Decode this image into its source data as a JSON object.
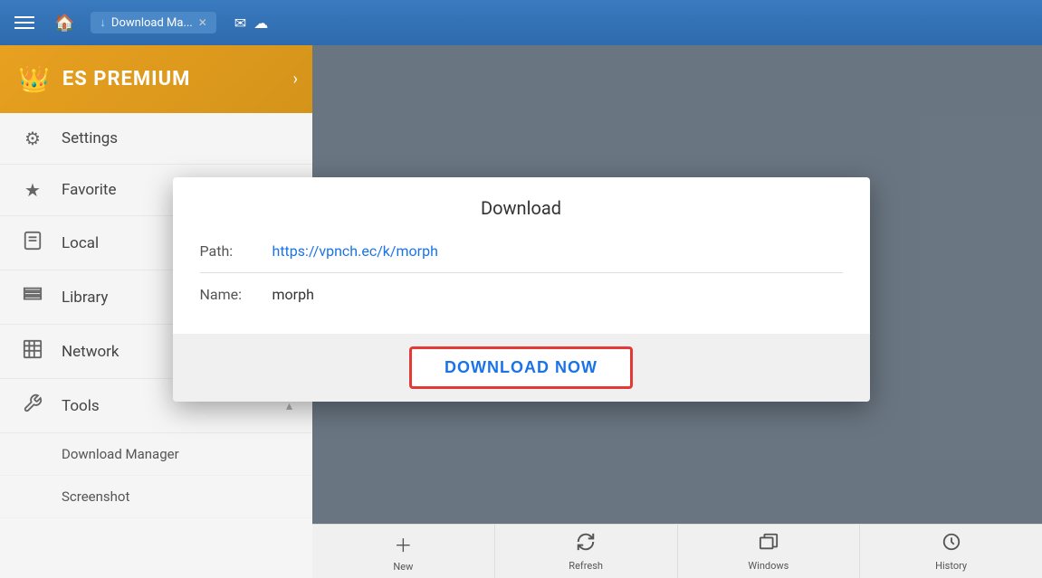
{
  "topBar": {
    "tabLabel": "Download Ma...",
    "icons": [
      "mail",
      "cloud"
    ]
  },
  "sidebar": {
    "premium": {
      "label": "ES PREMIUM",
      "crownIcon": "👑"
    },
    "items": [
      {
        "id": "settings",
        "label": "Settings",
        "icon": "⚙"
      },
      {
        "id": "favorite",
        "label": "Favorite",
        "icon": "★"
      },
      {
        "id": "local",
        "label": "Local",
        "icon": "📱"
      },
      {
        "id": "library",
        "label": "Library",
        "icon": "≡"
      },
      {
        "id": "network",
        "label": "Network",
        "icon": "▦"
      },
      {
        "id": "tools",
        "label": "Tools",
        "icon": "🔧"
      }
    ],
    "subitems": [
      {
        "id": "download-manager",
        "label": "Download Manager"
      },
      {
        "id": "screenshot",
        "label": "Screenshot"
      }
    ]
  },
  "dialog": {
    "title": "Download",
    "pathLabel": "Path:",
    "pathValue": "https://vpnch.ec/k/morph",
    "nameLabel": "Name:",
    "nameValue": "morph",
    "downloadButtonLabel": "DOWNLOAD NOW"
  },
  "bottomBar": {
    "buttons": [
      {
        "id": "new",
        "label": "New",
        "icon": "+"
      },
      {
        "id": "refresh",
        "label": "Refresh",
        "icon": "↻"
      },
      {
        "id": "windows",
        "label": "Windows",
        "icon": "⧉"
      },
      {
        "id": "history",
        "label": "History",
        "icon": "🕐"
      }
    ]
  }
}
